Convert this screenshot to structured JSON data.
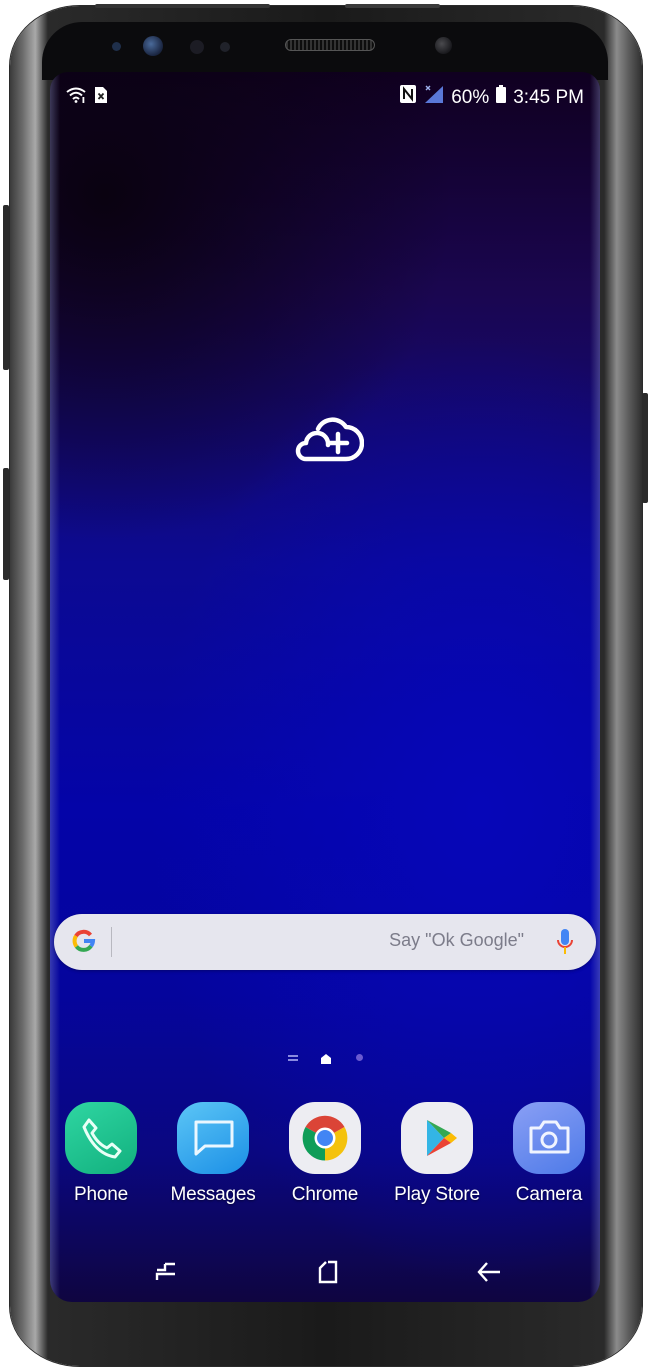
{
  "status_bar": {
    "left_icons": [
      "wifi-icon",
      "no-sim-icon"
    ],
    "right_icons": [
      "nfc-icon",
      "signal-icon",
      "battery-icon"
    ],
    "battery_percent": "60%",
    "time": "3:45 PM"
  },
  "home": {
    "center_icon": "cloud-add-icon"
  },
  "search_bar": {
    "logo": "google-g-icon",
    "placeholder": "Say \"Ok Google\"",
    "mic_icon": "mic-icon"
  },
  "page_indicator": {
    "items": [
      "apps-list-indicator",
      "home-indicator",
      "page-dot"
    ],
    "current": "home"
  },
  "dock": {
    "apps": [
      {
        "label": "Phone",
        "icon": "phone-icon",
        "color": "#1fc38f"
      },
      {
        "label": "Messages",
        "icon": "messages-icon",
        "color": "#36a8ee"
      },
      {
        "label": "Chrome",
        "icon": "chrome-icon",
        "color": "#ededf2"
      },
      {
        "label": "Play Store",
        "icon": "play-store-icon",
        "color": "#ededf2"
      },
      {
        "label": "Camera",
        "icon": "camera-icon",
        "color": "#6c8ff0"
      }
    ]
  },
  "navigation": {
    "recents": "recents-icon",
    "home": "home-icon",
    "back": "back-icon"
  },
  "colors": {
    "wallpaper_top": "#100020",
    "wallpaper_mid": "#0404a8",
    "search_bg": "#e6e6ee"
  }
}
